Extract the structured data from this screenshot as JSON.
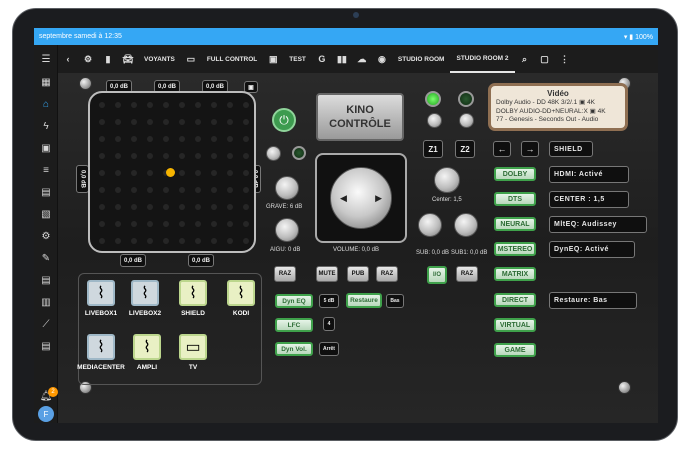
{
  "status": {
    "left": "septembre samedi à 12:35",
    "right": "100%"
  },
  "nav": {
    "tabs": [
      "VOYANTS",
      "FULL CONTROL",
      "TEST",
      "STUDIO ROOM",
      "STUDIO ROOM 2"
    ]
  },
  "pad": {
    "top_left": "0,0 dB",
    "top_center": "0,0 dB",
    "top_right": "0,0 dB",
    "left": "0,0 dB",
    "right": "0,0 dB",
    "bottom_left": "0,0 dB",
    "bottom_right": "0,0 dB"
  },
  "title": "KINO CONTRÔLE",
  "screen": {
    "title": "Vidéo",
    "line1": "Dolby Audio - DD 48K 3/2/.1",
    "line1_suffix": "4K",
    "line2": "DOLBY AUDIO-DD+NEURAL:X",
    "line2_suffix": "4K",
    "line3": "77 - Genesis - Seconds Out - Audio"
  },
  "knobs": {
    "grave": "GRAVE: 6 dB",
    "aigu": "AIGU: 0 dB",
    "volume": "VOLUME: 0,0 dB",
    "center": "Center: 1,5",
    "sub": "SUB: 0,0 dB",
    "sub1": "SUB1: 0,0 dB"
  },
  "zones": {
    "z1": "Z1",
    "z2": "Z2"
  },
  "shield": "SHIELD",
  "modes": [
    "DOLBY",
    "DTS",
    "NEURAL",
    "MSTEREO",
    "MATRIX",
    "DIRECT",
    "VIRTUAL",
    "GAME"
  ],
  "info": [
    "HDMI: Activé",
    "CENTER : 1,5",
    "MltEQ: Audissey",
    "DynEQ: Activé",
    "Restaure: Bas"
  ],
  "controls": {
    "raz": "RAZ",
    "mute": "MUTE",
    "pub": "PUB",
    "io": "I/O",
    "dyneq": "Dyn EQ",
    "dyneq_val": "5 dB",
    "restaure": "Restaure",
    "restaure_val": "Bas",
    "lfc": "LFC",
    "lfc_val": "4",
    "dynvol": "Dyn Vol.",
    "dynvol_val": "Arrêt"
  },
  "sources": [
    "LIVEBOX1",
    "LIVEBOX2",
    "SHIELD",
    "KODI",
    "MEDIACENTER",
    "AMPLI",
    "TV"
  ],
  "notifications": "2",
  "user_initial": "F"
}
